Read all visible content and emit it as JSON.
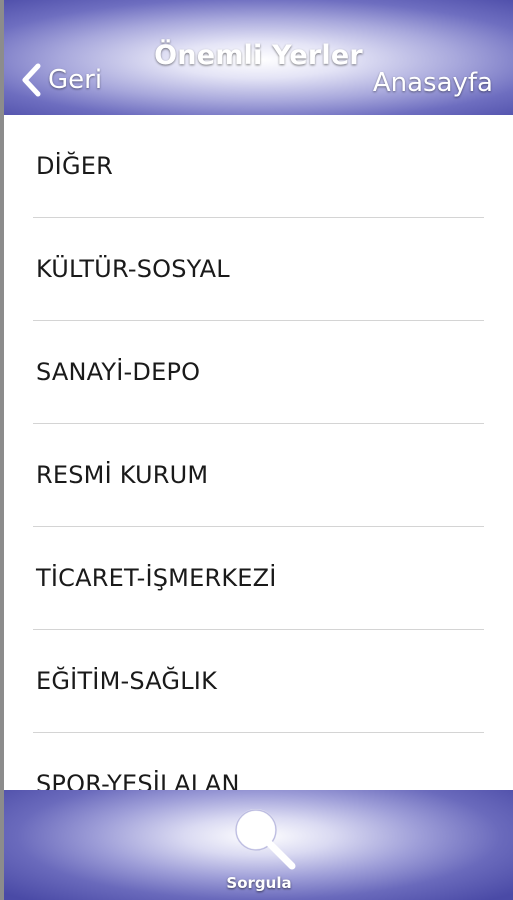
{
  "header": {
    "title": "Önemli Yerler",
    "back_label": "Geri",
    "home_label": "Anasayfa"
  },
  "list": {
    "items": [
      {
        "label": "DİĞER"
      },
      {
        "label": "KÜLTÜR-SOSYAL"
      },
      {
        "label": "SANAYİ-DEPO"
      },
      {
        "label": "RESMİ KURUM"
      },
      {
        "label": "TİCARET-İŞMERKEZİ"
      },
      {
        "label": "EĞİTİM-SAĞLIK"
      },
      {
        "label": "SPOR-YEŞİLALAN"
      }
    ]
  },
  "footer": {
    "search_label": "Sorgula",
    "search_icon": "search-icon"
  },
  "colors": {
    "bar_dark": "#4c4ca8",
    "bar_light": "#ffffff",
    "text": "#1a1a1a",
    "divider": "#d4d4d4"
  }
}
